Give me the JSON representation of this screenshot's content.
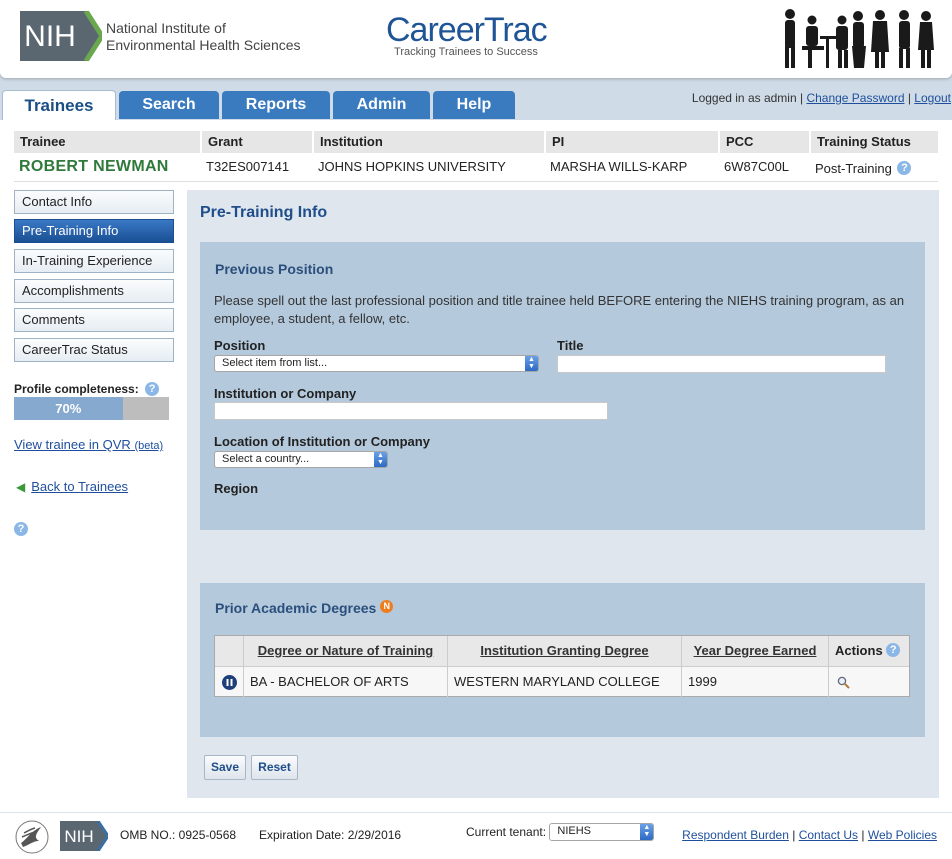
{
  "header": {
    "nih_logo": "NIH",
    "institute_line1": "National Institute of",
    "institute_line2": "Environmental Health Sciences",
    "app_title": "CareerTrac",
    "app_tagline": "Tracking Trainees to Success"
  },
  "tabs": [
    {
      "label": "Trainees",
      "active": true
    },
    {
      "label": "Search",
      "active": false
    },
    {
      "label": "Reports",
      "active": false
    },
    {
      "label": "Admin",
      "active": false
    },
    {
      "label": "Help",
      "active": false
    }
  ],
  "user": {
    "logged_in_text": "Logged in as admin",
    "change_password": "Change Password",
    "logout": "Logout"
  },
  "trainee": {
    "headers": [
      "Trainee",
      "Grant",
      "Institution",
      "PI",
      "PCC",
      "Training Status"
    ],
    "name": "ROBERT NEWMAN",
    "grant": "T32ES007141",
    "institution": "JOHNS HOPKINS UNIVERSITY",
    "pi": "MARSHA WILLS-KARP",
    "pcc": "6W87C00L",
    "status": "Post-Training"
  },
  "sidebar": {
    "items": [
      {
        "label": "Contact Info",
        "active": false
      },
      {
        "label": "Pre-Training Info",
        "active": true
      },
      {
        "label": "In-Training Experience",
        "active": false
      },
      {
        "label": "Accomplishments",
        "active": false
      },
      {
        "label": "Comments",
        "active": false
      },
      {
        "label": "CareerTrac Status",
        "active": false
      }
    ],
    "profile_label": "Profile completeness:",
    "profile_percent_text": "70%",
    "profile_fraction": 0.7,
    "qvr_link": "View trainee in QVR",
    "qvr_beta": "(beta)",
    "back_link": "Back to Trainees"
  },
  "content": {
    "title": "Pre-Training Info",
    "previous_position": {
      "heading": "Previous Position",
      "instructions": "Please spell out the last professional position and title trainee held BEFORE entering the NIEHS training program, as an employee, a student, a fellow, etc.",
      "position_label": "Position",
      "position_value": "Select item from list...",
      "title_label": "Title",
      "title_value": "",
      "institution_label": "Institution or Company",
      "institution_value": "",
      "location_label": "Location of Institution or Company",
      "location_value": "Select a country...",
      "region_label": "Region"
    },
    "degrees": {
      "heading": "Prior Academic Degrees",
      "badge": "N",
      "columns": [
        "Degree or Nature of Training",
        "Institution Granting Degree",
        "Year Degree Earned",
        "Actions"
      ],
      "rows": [
        {
          "degree": "BA - BACHELOR OF ARTS",
          "institution": "WESTERN MARYLAND COLLEGE",
          "year": "1999"
        }
      ]
    },
    "save_label": "Save",
    "reset_label": "Reset"
  },
  "footer": {
    "nih": "NIH",
    "omb": "OMB NO.: 0925-0568",
    "expiration": "Expiration Date: 2/29/2016",
    "tenant_label": "Current tenant:",
    "tenant_value": "NIEHS",
    "links": [
      "Respondent Burden",
      "Contact Us",
      "Web Policies"
    ]
  },
  "colors": {
    "accent": "#1f5596",
    "tab_blue": "#3a7bbf",
    "trainee_green": "#2f7a3b",
    "panel_blue": "#b5c9dc"
  }
}
